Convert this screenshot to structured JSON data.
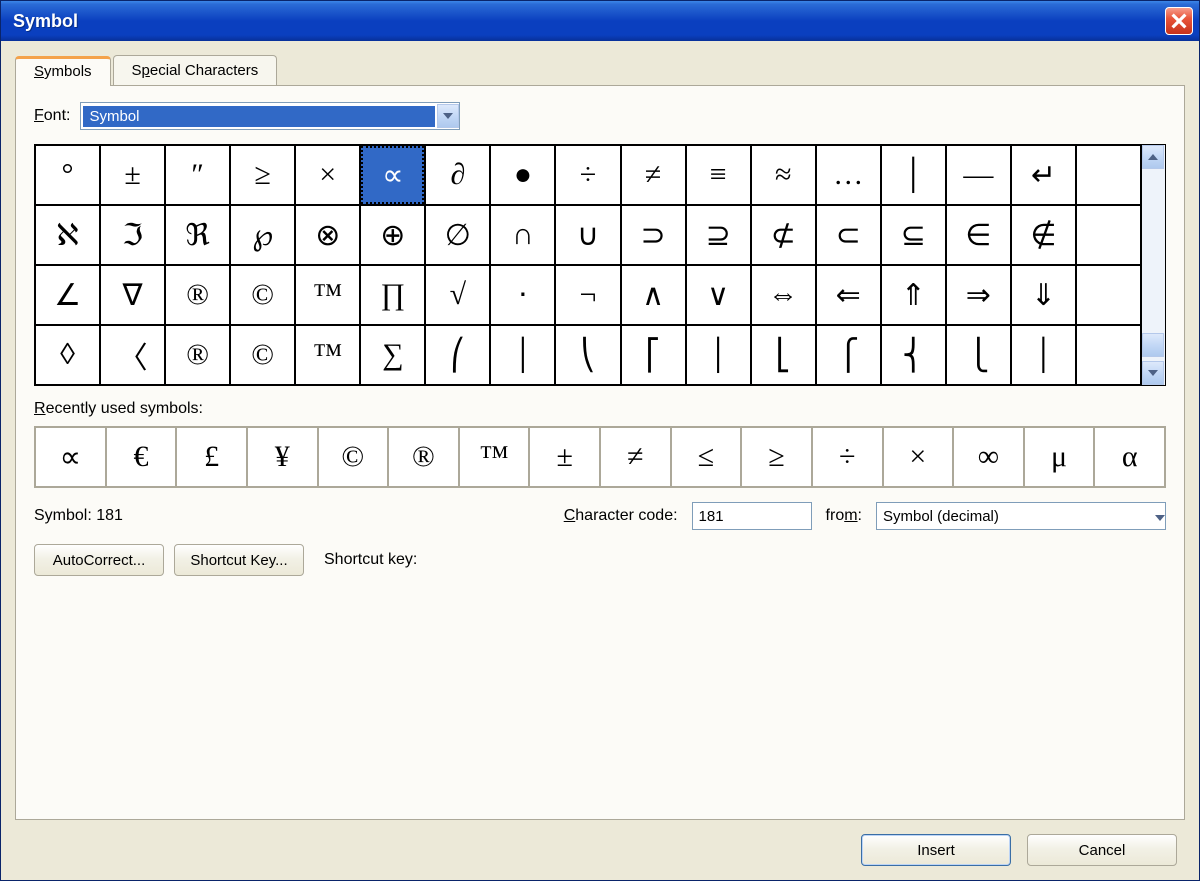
{
  "window": {
    "title": "Symbol"
  },
  "tabs": {
    "symbols": "Symbols",
    "special": "Special Characters"
  },
  "font": {
    "label": "Font:",
    "value": "Symbol"
  },
  "grid": {
    "selected_index": 5,
    "cells": [
      "°",
      "±",
      "″",
      "≥",
      "×",
      "∝",
      "∂",
      "●",
      "÷",
      "≠",
      "≡",
      "≈",
      "…",
      "│",
      "—",
      "↵",
      "ℵ",
      "ℑ",
      "ℜ",
      "℘",
      "⊗",
      "⊕",
      "∅",
      "∩",
      "∪",
      "⊃",
      "⊇",
      "⊄",
      "⊂",
      "⊆",
      "∈",
      "∉",
      "∠",
      "∇",
      "®",
      "©",
      "™",
      "∏",
      "√",
      "⋅",
      "¬",
      "∧",
      "∨",
      "⇔",
      "⇐",
      "⇑",
      "⇒",
      "⇓",
      "◊",
      "〈",
      "®",
      "©",
      "™",
      "∑",
      "⎛",
      "│",
      "⎝",
      "⎡",
      "│",
      "⎣",
      "⎧",
      "⎨",
      "⎩",
      "│"
    ]
  },
  "recent": {
    "label": "Recently used symbols:",
    "cells": [
      "∝",
      "€",
      "£",
      "¥",
      "©",
      "®",
      "™",
      "±",
      "≠",
      "≤",
      "≥",
      "÷",
      "×",
      "∞",
      "μ",
      "α"
    ]
  },
  "code": {
    "symbol_label": "Symbol: 181",
    "char_label": "Character code:",
    "char_value": "181",
    "from_label": "from:",
    "from_value": "Symbol (decimal)"
  },
  "buttons": {
    "autocorrect": "AutoCorrect...",
    "shortcutkey": "Shortcut Key...",
    "shortcut_label": "Shortcut key:",
    "insert": "Insert",
    "cancel": "Cancel"
  }
}
